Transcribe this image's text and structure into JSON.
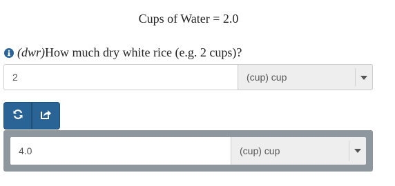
{
  "header": {
    "title": "Cups of Water = 2.0"
  },
  "question": {
    "icon": "info-circle-icon",
    "variable": "(dwr)",
    "text": "How much dry white rice (e.g. 2 cups)?"
  },
  "input": {
    "value": "2",
    "unit_selected": "(cup) cup"
  },
  "toolbar": {
    "refresh_icon": "refresh-icon",
    "share_icon": "share-icon",
    "button_color": "#2a6496"
  },
  "result": {
    "value": "4.0",
    "unit_selected": "(cup) cup",
    "panel_color": "#8e979e"
  }
}
